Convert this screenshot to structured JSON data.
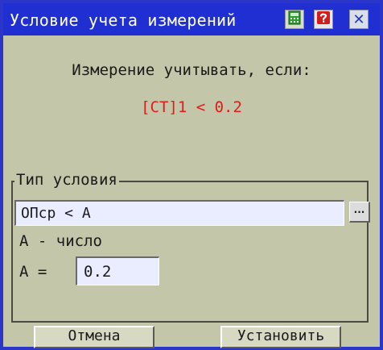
{
  "window": {
    "title": "Условие учета измерений",
    "close_symbol": "✕"
  },
  "icons": {
    "calculator": "calculator-icon",
    "help": "help-icon",
    "close": "close-icon"
  },
  "colors": {
    "titlebar": "#1f2fd1",
    "window_bg": "#c3c6a8",
    "condition_text": "#e21b1b",
    "help_icon": "#d11d1d",
    "calc_icon": "#2f9a2f"
  },
  "header": {
    "prompt": "Измерение учитывать, если:",
    "condition": "[CT]1 < 0.2"
  },
  "condition_type": {
    "group_label": "Тип условия",
    "value": "ОПср  < А",
    "browse_label": "...",
    "a_description": "А  - число",
    "a_label": "А  =",
    "a_value": "0.2"
  },
  "buttons": {
    "cancel": "Отмена",
    "set": "Установить"
  }
}
